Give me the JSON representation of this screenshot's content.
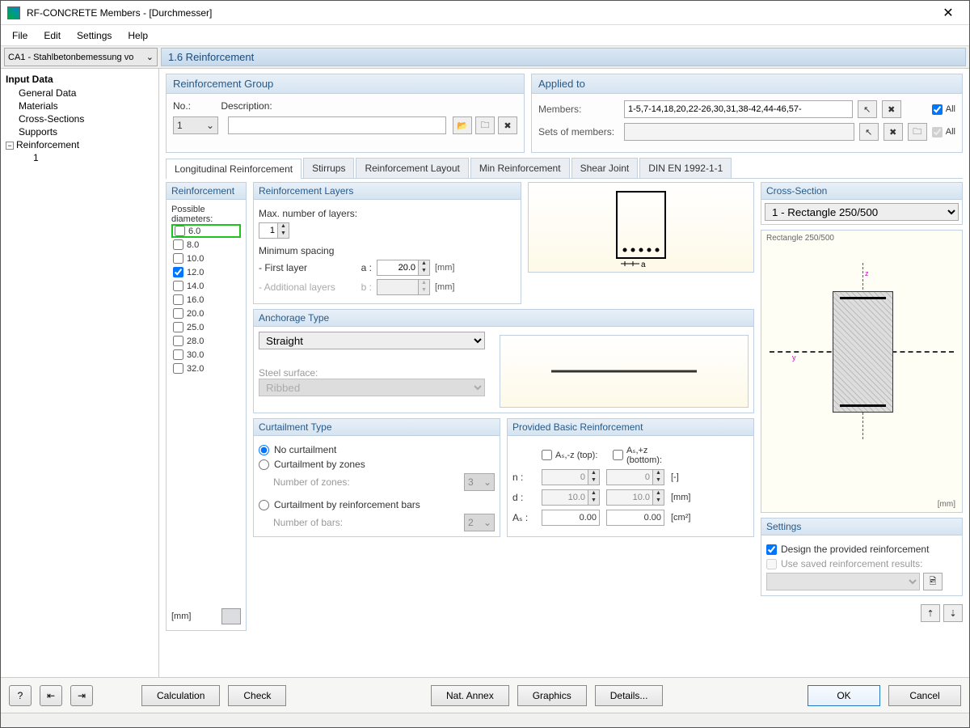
{
  "window": {
    "title": "RF-CONCRETE Members - [Durchmesser]"
  },
  "menu": {
    "file": "File",
    "edit": "Edit",
    "settings": "Settings",
    "help": "Help"
  },
  "case_selector": "CA1 - Stahlbetonbemessung vo",
  "step_title": "1.6 Reinforcement",
  "tree": {
    "header": "Input Data",
    "items": [
      "General Data",
      "Materials",
      "Cross-Sections",
      "Supports"
    ],
    "reinforcement": "Reinforcement",
    "reinforcement_children": [
      "1"
    ]
  },
  "reinforcement_group": {
    "title": "Reinforcement Group",
    "no_label": "No.:",
    "no_value": "1",
    "desc_label": "Description:",
    "desc_value": ""
  },
  "applied_to": {
    "title": "Applied to",
    "members_label": "Members:",
    "members_value": "1-5,7-14,18,20,22-26,30,31,38-42,44-46,57-",
    "sets_label": "Sets of members:",
    "sets_value": "",
    "all": "All"
  },
  "tabs": [
    "Longitudinal Reinforcement",
    "Stirrups",
    "Reinforcement Layout",
    "Min Reinforcement",
    "Shear Joint",
    "DIN EN 1992-1-1"
  ],
  "diameters_panel": {
    "title": "Reinforcement",
    "label": "Possible diameters:",
    "values": [
      "6.0",
      "8.0",
      "10.0",
      "12.0",
      "14.0",
      "16.0",
      "20.0",
      "25.0",
      "28.0",
      "30.0",
      "32.0"
    ],
    "checked": [
      false,
      false,
      false,
      true,
      false,
      false,
      false,
      false,
      false,
      false,
      false
    ],
    "unit": "[mm]"
  },
  "layers": {
    "title": "Reinforcement Layers",
    "max_label": "Max. number of layers:",
    "max_value": "1",
    "spacing_label": "Minimum spacing",
    "first_label": "- First layer",
    "first_sym": "a :",
    "first_value": "20.0",
    "first_unit": "[mm]",
    "add_label": "- Additional layers",
    "add_sym": "b :",
    "add_value": "",
    "add_unit": "[mm]"
  },
  "anchorage": {
    "title": "Anchorage Type",
    "value": "Straight",
    "surface_label": "Steel surface:",
    "surface_value": "Ribbed"
  },
  "curtailment": {
    "title": "Curtailment Type",
    "none": "No curtailment",
    "zones": "Curtailment by zones",
    "zones_num_label": "Number of zones:",
    "zones_num": "3",
    "bars": "Curtailment by reinforcement bars",
    "bars_num_label": "Number of bars:",
    "bars_num": "2"
  },
  "provided": {
    "title": "Provided Basic Reinforcement",
    "top_label": "Aₛ,-z (top):",
    "bottom_label": "Aₛ,+z (bottom):",
    "n_label": "n :",
    "n_top": "0",
    "n_bot": "0",
    "n_unit": "[-]",
    "d_label": "d :",
    "d_top": "10.0",
    "d_bot": "10.0",
    "d_unit": "[mm]",
    "as_label": "Aₛ :",
    "as_top": "0.00",
    "as_bot": "0.00",
    "as_unit": "[cm²]"
  },
  "cross_section": {
    "title": "Cross-Section",
    "value": "1 - Rectangle 250/500",
    "caption": "Rectangle 250/500",
    "unit": "[mm]"
  },
  "settings_panel": {
    "title": "Settings",
    "design_provided": "Design the provided reinforcement",
    "use_saved": "Use saved reinforcement results:"
  },
  "buttons": {
    "calc": "Calculation",
    "check": "Check",
    "annex": "Nat. Annex",
    "graphics": "Graphics",
    "details": "Details...",
    "ok": "OK",
    "cancel": "Cancel"
  }
}
